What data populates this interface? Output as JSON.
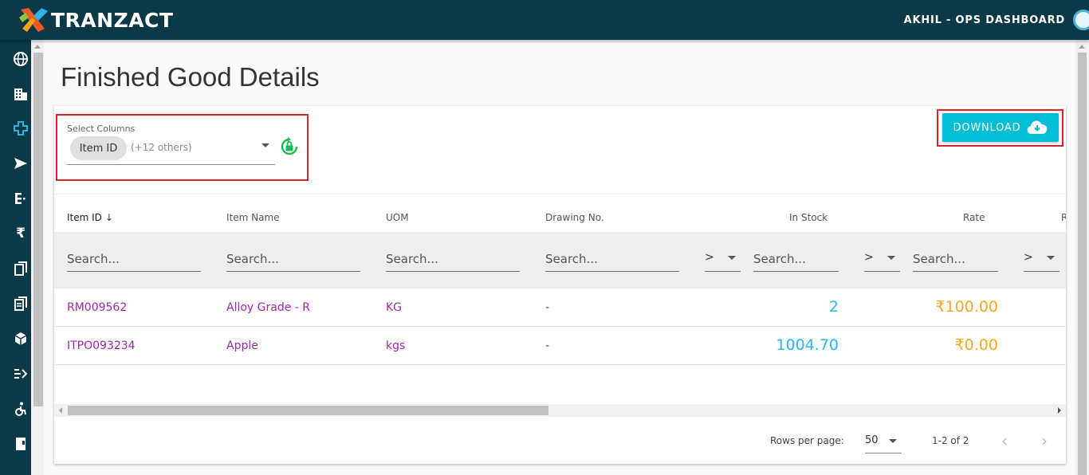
{
  "app": {
    "brand": "TRANZACT",
    "user_label": "AKHIL - OPS DASHBOARD"
  },
  "sidebar": {
    "icons": [
      "globe-icon",
      "building-icon",
      "plus-cross-icon",
      "send-icon",
      "list-icon",
      "rupee-icon",
      "copy-icon",
      "document-icon",
      "cube-icon",
      "flow-icon",
      "accessibility-icon",
      "file-icon"
    ]
  },
  "page": {
    "title": "Finished Good Details"
  },
  "column_select": {
    "label": "Select Columns",
    "chip": "Item ID",
    "others": "(+12 others)"
  },
  "download": {
    "label": "DOWNLOAD"
  },
  "table": {
    "headers": {
      "item_id": "Item ID",
      "sort_arrow": "↓",
      "item_name": "Item Name",
      "uom": "UOM",
      "drawing_no": "Drawing No.",
      "in_stock": "In Stock",
      "rate": "Rate",
      "next": "R"
    },
    "filter": {
      "placeholder": "Search...",
      "operator": ">"
    },
    "rows": [
      {
        "item_id": "RM009562",
        "item_name": "Alloy Grade - R",
        "uom": "KG",
        "drawing_no": "-",
        "in_stock": "2",
        "rate": "₹100.00"
      },
      {
        "item_id": "ITPO093234",
        "item_name": "Apple",
        "uom": "kgs",
        "drawing_no": "-",
        "in_stock": "1004.70",
        "rate": "₹0.00"
      }
    ]
  },
  "footer": {
    "rows_per_page_label": "Rows per page:",
    "rows_per_page_value": "50",
    "range": "1-2 of 2",
    "prev": "‹",
    "next": "›"
  },
  "colors": {
    "topbar": "#0c3948",
    "accent": "#00bcd4",
    "link_purple": "#9c27b0",
    "stock_blue": "#29b6f6",
    "rate_orange": "#f5a623",
    "highlight_red": "#e0202a",
    "lock_green": "#1db954"
  }
}
